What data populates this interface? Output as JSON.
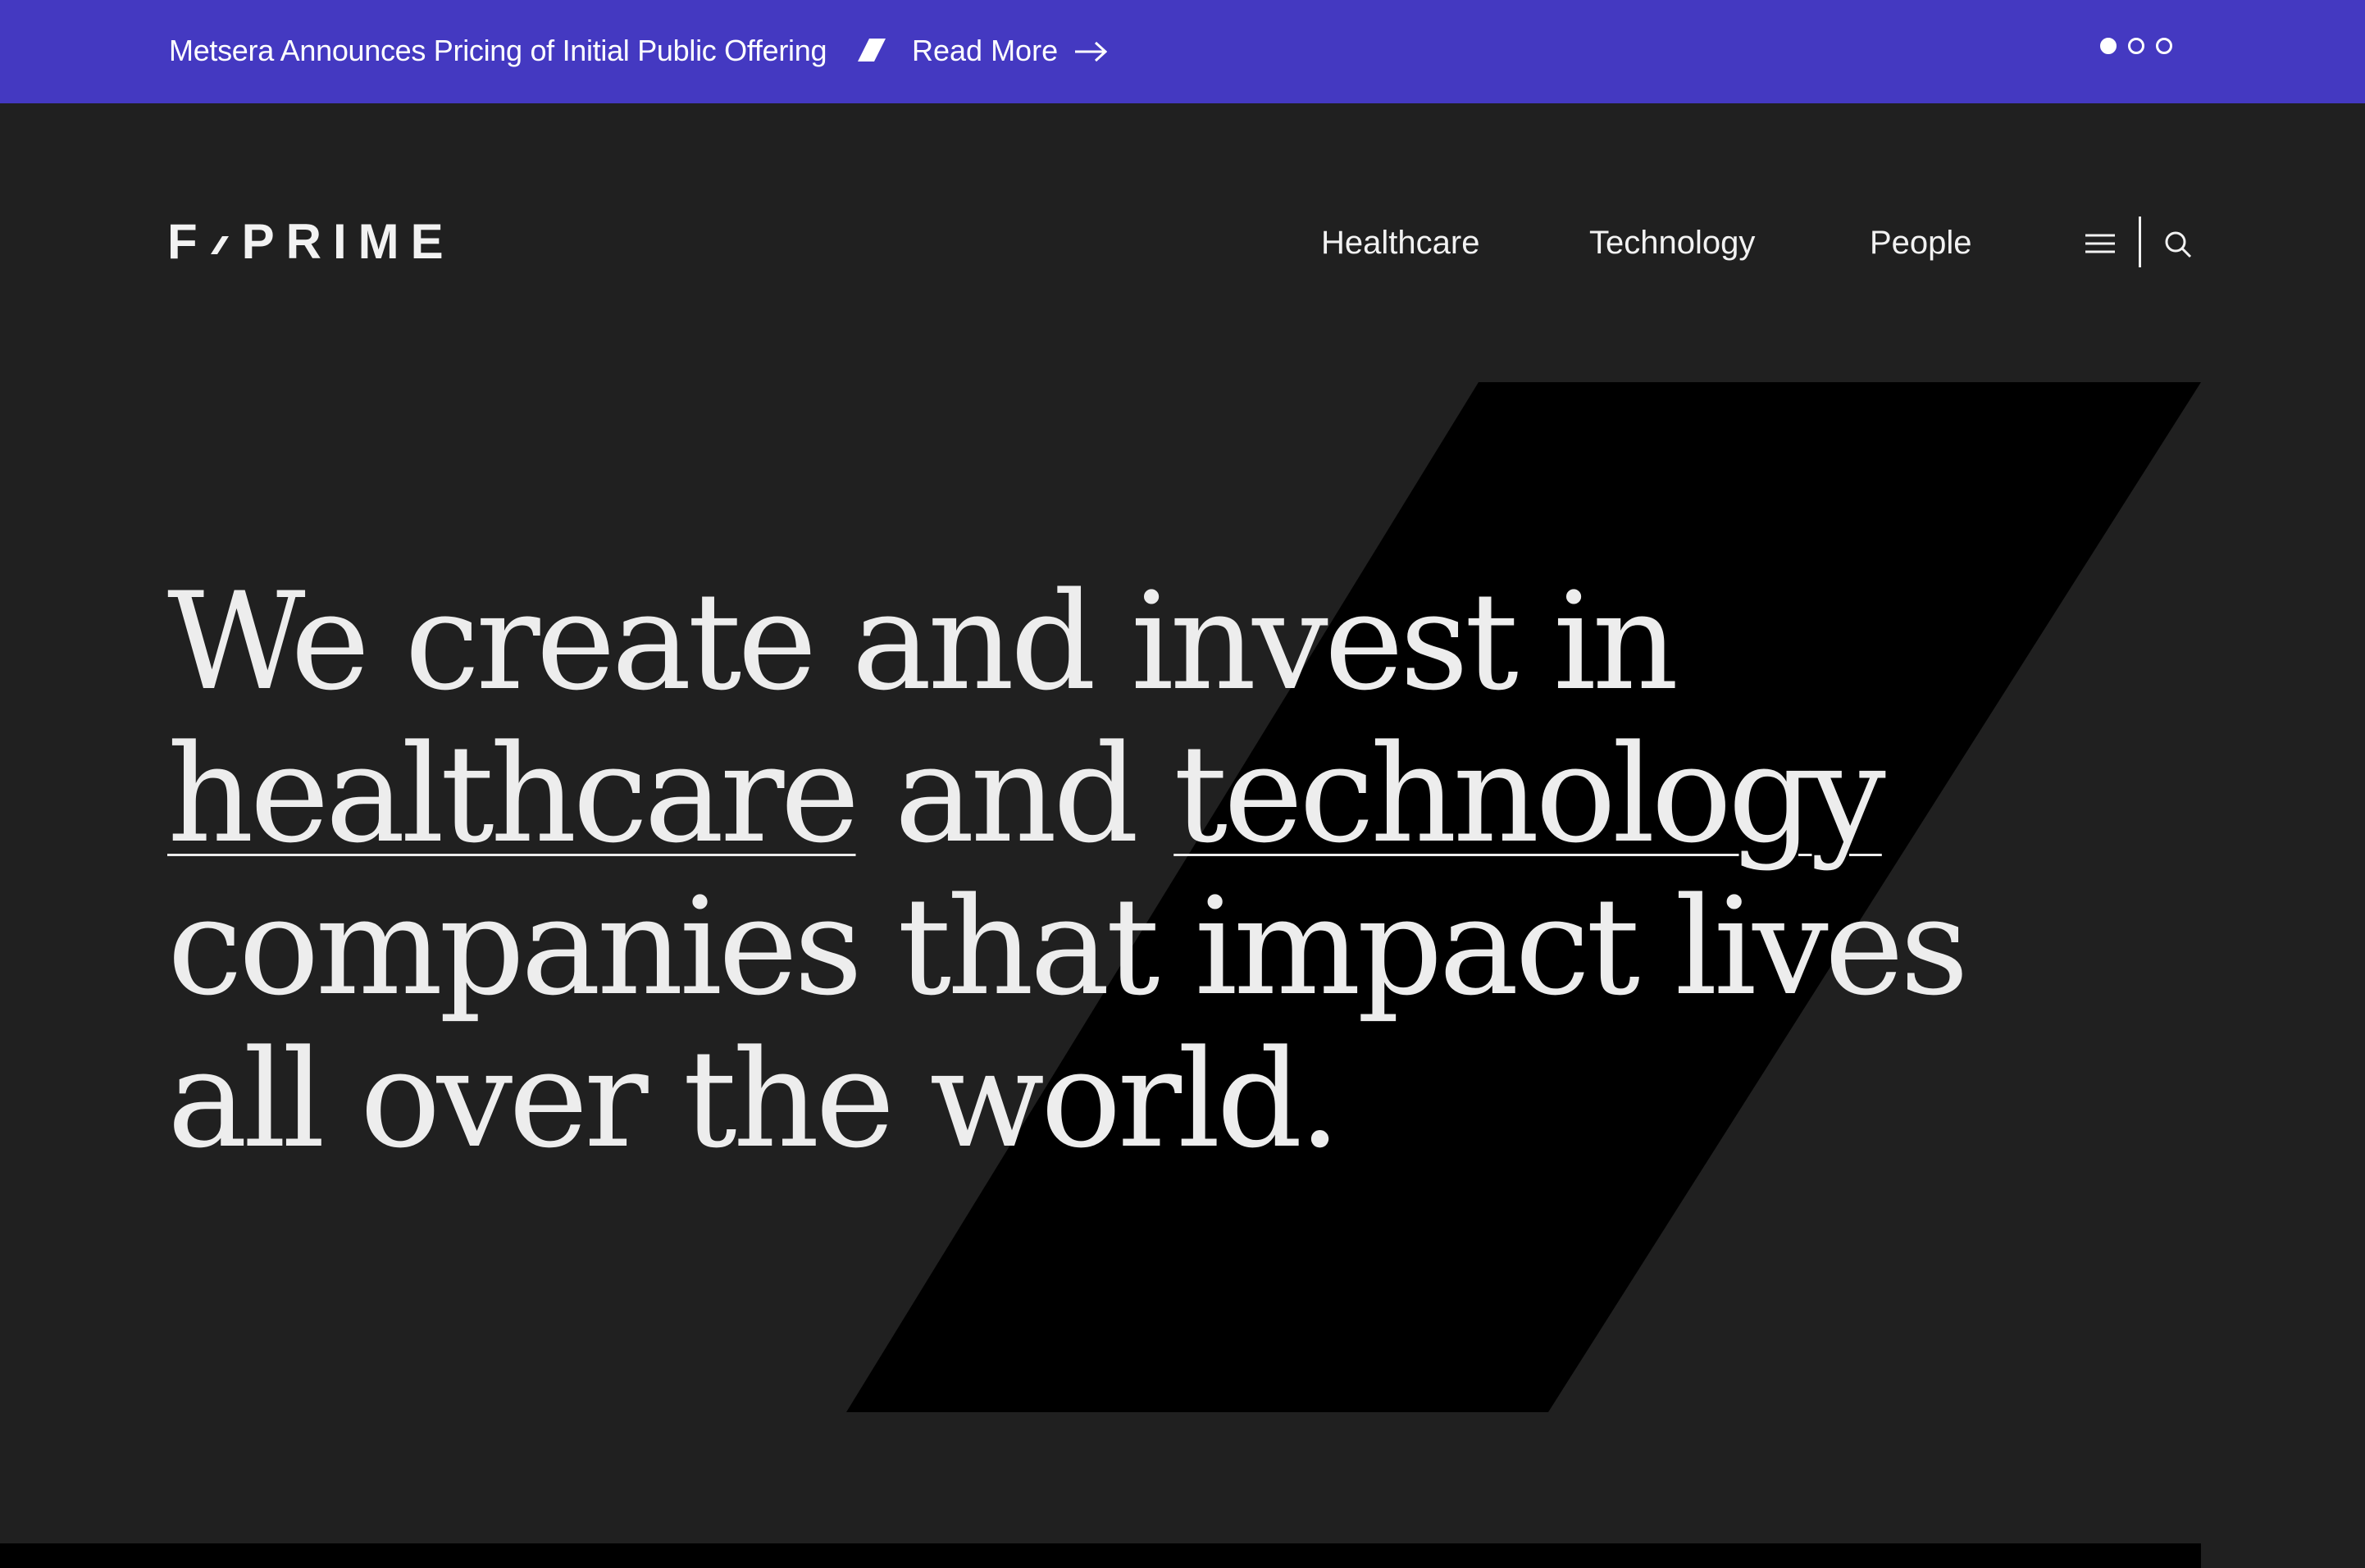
{
  "announcement": {
    "text": "Metsera Announces Pricing of Initial Public Offering",
    "read_more": "Read More",
    "slides": 3,
    "active_slide": 1
  },
  "header": {
    "logo_left": "F",
    "logo_right": "PRIME",
    "nav": [
      {
        "label": "Healthcare"
      },
      {
        "label": "Technology"
      },
      {
        "label": "People"
      }
    ],
    "menu_icon": "hamburger-icon",
    "search_icon": "search-icon"
  },
  "hero": {
    "line1": "We create and invest in",
    "link_healthcare": "healthcare",
    "and": "and",
    "link_technology": "technology",
    "line3": "companies that impact lives",
    "line4": "all over the world."
  },
  "colors": {
    "announcement_bg": "#4439c1",
    "page_bg": "#202020",
    "shape": "#000000",
    "text": "#ededed"
  }
}
